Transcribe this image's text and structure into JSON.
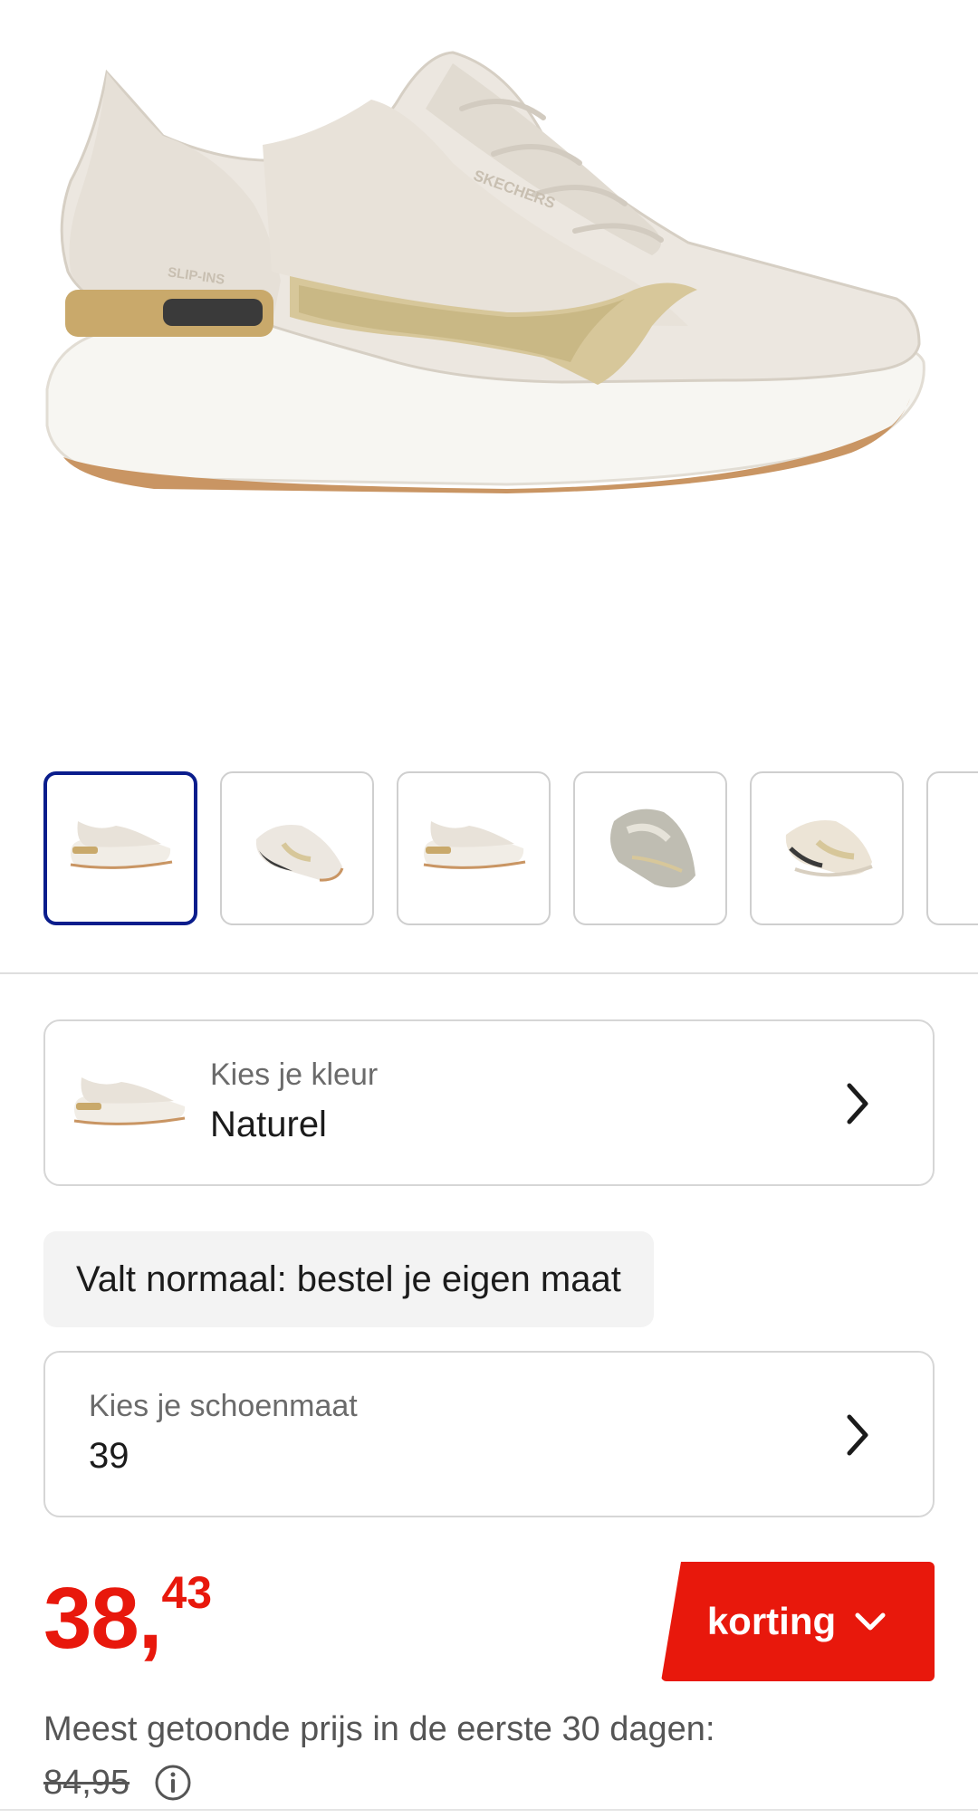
{
  "product": {
    "image_alt": "Witte Skechers Slip-ins sneaker met gouden accenten",
    "brand_mark": "SKECHERS",
    "sub_mark": "SLIP-INS"
  },
  "gallery": {
    "thumbnails": [
      {
        "name": "thumbnail-1",
        "view": "side",
        "selected": true
      },
      {
        "name": "thumbnail-2",
        "view": "angle"
      },
      {
        "name": "thumbnail-3",
        "view": "side"
      },
      {
        "name": "thumbnail-4",
        "view": "top"
      },
      {
        "name": "thumbnail-5",
        "view": "angle-light"
      },
      {
        "name": "thumbnail-6",
        "view": "partial"
      }
    ]
  },
  "color_selector": {
    "label": "Kies je kleur",
    "value": "Naturel"
  },
  "fit_hint": "Valt normaal: bestel je eigen maat",
  "size_selector": {
    "label": "Kies je schoenmaat",
    "value": "39"
  },
  "price": {
    "euros": "38,",
    "cents": "43",
    "discount_label": "korting",
    "low_price_note": "Meest getoonde prijs in de eerste 30 dagen:",
    "old_price": "84,95"
  },
  "colors": {
    "accent_red": "#e8180c",
    "selected_border": "#0a1d8c",
    "text": "#1b1b1b",
    "muted": "#6b6b6b"
  }
}
